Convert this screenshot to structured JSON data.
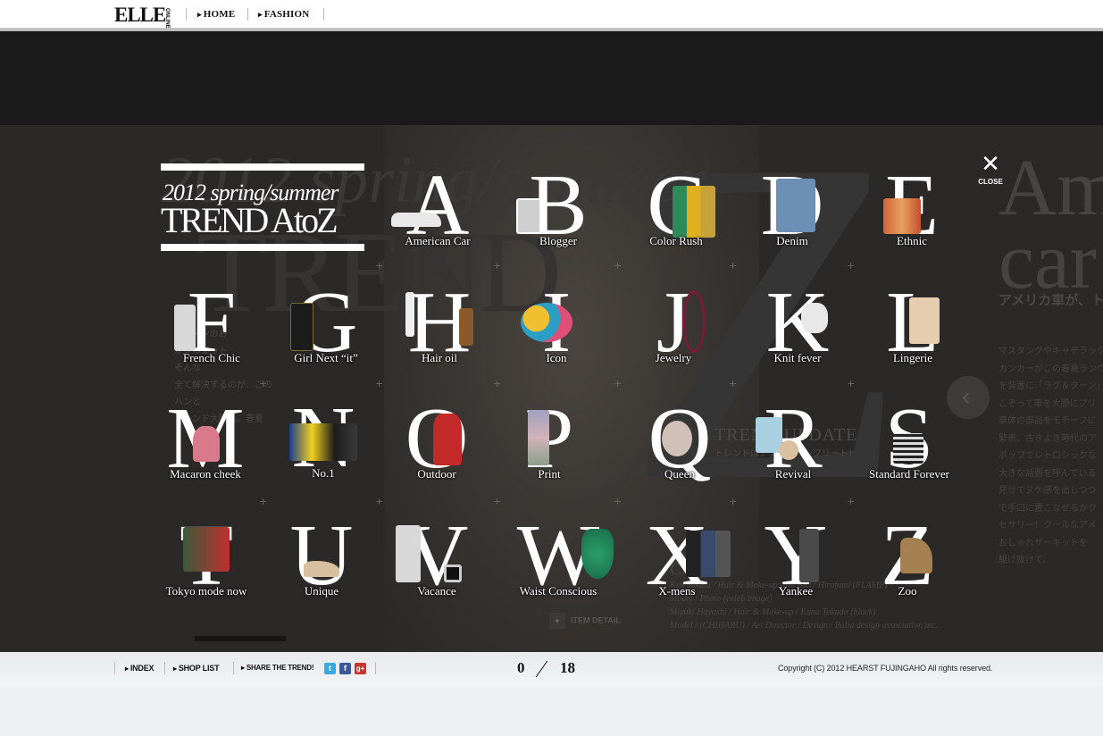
{
  "header": {
    "logo": "ELLE",
    "logo_sub": "ONLINE",
    "nav": [
      "HOME",
      "FASHION"
    ]
  },
  "title": {
    "line1": "2012 spring/summer",
    "line2": "TREND AtoZ"
  },
  "close_label": "CLOSE",
  "letters": [
    {
      "letter": "A",
      "caption": "American Car"
    },
    {
      "letter": "B",
      "caption": "Blogger"
    },
    {
      "letter": "C",
      "caption": "Color Rush"
    },
    {
      "letter": "D",
      "caption": "Denim"
    },
    {
      "letter": "E",
      "caption": "Ethnic"
    },
    {
      "letter": "F",
      "caption": "French Chic"
    },
    {
      "letter": "G",
      "caption": "Girl Next “it”"
    },
    {
      "letter": "H",
      "caption": "Hair oil"
    },
    {
      "letter": "I",
      "caption": "Icon"
    },
    {
      "letter": "J",
      "caption": "Jewelry"
    },
    {
      "letter": "K",
      "caption": "Knit fever"
    },
    {
      "letter": "L",
      "caption": "Lingerie"
    },
    {
      "letter": "M",
      "caption": "Macaron cheek"
    },
    {
      "letter": "N",
      "caption": "No.1"
    },
    {
      "letter": "O",
      "caption": "Outdoor"
    },
    {
      "letter": "P",
      "caption": "Print"
    },
    {
      "letter": "Q",
      "caption": "Queen"
    },
    {
      "letter": "R",
      "caption": "Revival"
    },
    {
      "letter": "S",
      "caption": "Standard Forever"
    },
    {
      "letter": "T",
      "caption": "Tokyo mode now"
    },
    {
      "letter": "U",
      "caption": "Unique"
    },
    {
      "letter": "V",
      "caption": "Vacance"
    },
    {
      "letter": "W",
      "caption": "Waist Conscious"
    },
    {
      "letter": "X",
      "caption": "X-mens"
    },
    {
      "letter": "Y",
      "caption": "Yankee"
    },
    {
      "letter": "Z",
      "caption": "Zoo"
    }
  ],
  "background": {
    "script_text": "2012 spring/summer",
    "trend_text": "TREND",
    "big_letter": "Z",
    "right_heading": "American car",
    "right_jp_title": "アメリカ車が、トレンドを提走",
    "right_jp_body": [
      "マスタングやキャデラック",
      "カンカーがこの春夏ランウ",
      "を装置に「ラグ＆ターン」",
      "こぞって車を大胆にプリ",
      "車体の部品をモチーフに",
      "繁表、古きよき時代のア",
      "ポップでレトロシックな",
      "大きな話題を呼んでいる",
      "見せてヌケ感を出しつつ",
      "で手口に置こなせるかク",
      "セサリー！クールなアメ",
      "おしゃれサーキットを",
      "駆け抜けて。"
    ],
    "left_jp_body": [
      "シーズンのお",
      "がシルエット",
      "そんな",
      "全て解決するのが、この",
      "ハンと",
      "トレンド大図鑑。春夏"
    ],
    "trend_update": "TREND UPDATE",
    "trend_update_sub": "トレンドはアプリでコンプリート！",
    "credits": [
      "Credits",
      "Ken Sakata / Hair & Make-up (hill BR) / Hirofumi (FLAME)",
      "Model / Photo (celeb image)",
      "Miyuki Hayashi / Hair & Make-up / Kana Tokuda (black)",
      "Model / (CHIHARU) / Art Director / Design / Balia design association inc."
    ],
    "item_detail": "ITEM DETAIL"
  },
  "footer": {
    "links": [
      "INDEX",
      "SHOP LIST",
      "SHARE THE TREND!"
    ],
    "page_current": "0",
    "page_total": "18",
    "copyright": "Copyright (C) 2012 HEARST FUJINGAHO All rights reserved."
  },
  "colors": {
    "twitter": "#3aa9e0",
    "facebook": "#3b5998",
    "googleplus": "#c8322b",
    "stage_bg": "#2a2928"
  }
}
